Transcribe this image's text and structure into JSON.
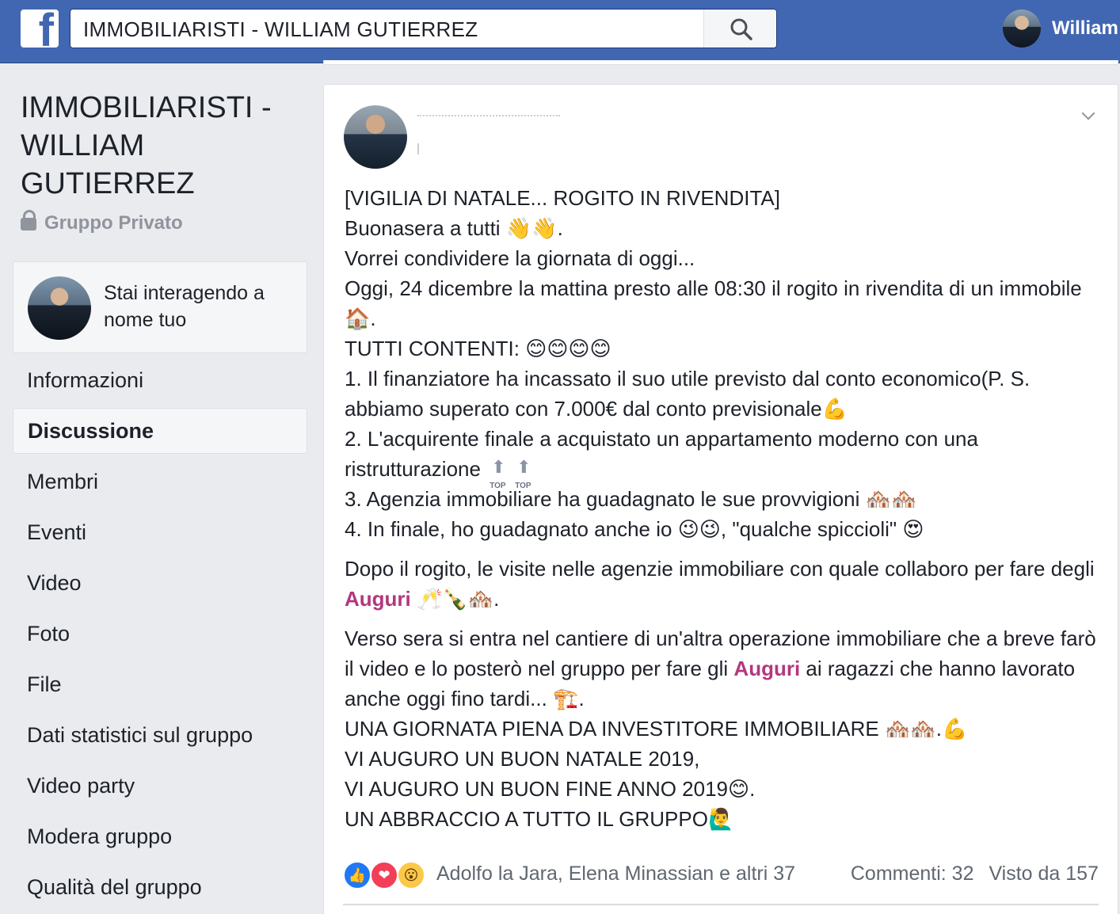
{
  "topbar": {
    "logo": "facebook-logo",
    "search_value": "IMMOBILIARISTI - WILLIAM GUTIERREZ",
    "user_name": "William"
  },
  "group": {
    "title": "IMMOBILIARISTI - WILLIAM GUTIERREZ",
    "privacy": "Gruppo Privato",
    "acting_as": "Stai interagendo a nome tuo"
  },
  "nav": {
    "items": [
      {
        "label": "Informazioni"
      },
      {
        "label": "Discussione",
        "active": true
      },
      {
        "label": "Membri"
      },
      {
        "label": "Eventi"
      },
      {
        "label": "Video"
      },
      {
        "label": "Foto"
      },
      {
        "label": "File"
      },
      {
        "label": "Dati statistici sul gruppo"
      },
      {
        "label": "Video party"
      },
      {
        "label": "Modera gruppo"
      },
      {
        "label": "Qualità del gruppo"
      }
    ]
  },
  "post": {
    "lines": [
      "[VIGILIA DI NATALE... ROGITO IN RIVENDITA]",
      "Buonasera a tutti",
      "Vorrei condividere la giornata di oggi...",
      "Oggi, 24 dicembre la mattina presto alle 08:30 il rogito in rivendita di un immobile",
      "TUTTI CONTENTI:",
      "1. Il finanziatore ha incassato il suo utile previsto dal conto economico(P. S. abbiamo superato con 7.000€ dal conto previsionale",
      "2. L'acquirente finale a acquistato un appartamento moderno con una ristrutturazione",
      "3. Agenzia immobiliare ha guadagnato le sue provvigioni",
      "4. In finale, ho guadagnato anche io",
      "\"qualche spiccioli\""
    ],
    "para2_a": "Dopo il rogito, le visite nelle agenzie immobiliare con quale collaboro per fare degli",
    "highlight": "Auguri",
    "para3_a": "Verso sera si entra nel cantiere di un'altra operazione immobiliare che a breve farò il video e lo posterò nel gruppo per fare gli",
    "para3_b": "ai ragazzi che hanno lavorato anche oggi fino tardi...",
    "closing": [
      "UNA GIORNATA PIENA DA INVESTITORE IMMOBILIARE",
      "VI AUGURO UN BUON NATALE 2019,",
      "VI AUGURO UN BUON FINE ANNO 2019",
      "UN ABBRACCIO A TUTTO IL GRUPPO"
    ],
    "emoji": {
      "wave": "👋👋",
      "house": "🏠",
      "smiles": "😊😊😊😊",
      "muscle": "💪",
      "houses": "🏘️🏘️",
      "winks": "😉😉",
      "heart_eyes": "😍",
      "toast": "🥂🍾🏘️",
      "crane": "🏗️",
      "smile": "😊",
      "wave_man": "🙋‍♂️"
    }
  },
  "reactions": {
    "names": "Adolfo la Jara, Elena Minassian e altri 37",
    "comments": "Commenti: 32",
    "seen": "Visto da 157",
    "like_icon": "👍",
    "love_icon": "❤",
    "wow_icon": "😮"
  }
}
